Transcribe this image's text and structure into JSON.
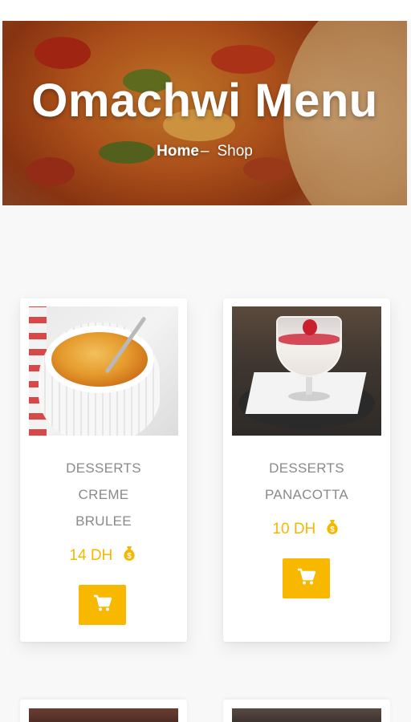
{
  "hero": {
    "title": "Omachwi Menu",
    "breadcrumb": {
      "home": "Home",
      "separator": "–",
      "current": "Shop"
    }
  },
  "products": [
    {
      "category": "DESSERTS",
      "name_line1": "CREME",
      "name_line2": "BRULEE",
      "price": "14 DH",
      "image_icon": "creme-brulee-photo",
      "cart_icon": "cart-icon"
    },
    {
      "category": "DESSERTS",
      "name_line1": "PANACOTTA",
      "price": "10 DH",
      "image_icon": "panacotta-photo",
      "cart_icon": "cart-icon"
    }
  ],
  "colors": {
    "accent": "#f9b800",
    "price": "#f5b800",
    "text_muted": "#8a8a8a",
    "card": "#ffffff",
    "background": "#f8f8f8"
  }
}
